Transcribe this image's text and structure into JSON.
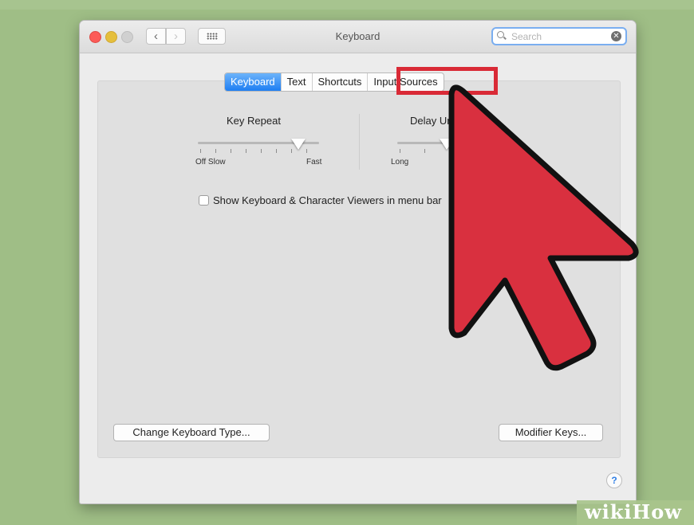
{
  "window": {
    "title": "Keyboard"
  },
  "search": {
    "placeholder": "Search"
  },
  "tabs": [
    {
      "label": "Keyboard",
      "selected": true
    },
    {
      "label": "Text",
      "selected": false
    },
    {
      "label": "Shortcuts",
      "selected": false
    },
    {
      "label": "Input Sources",
      "selected": false,
      "highlighted": true
    }
  ],
  "key_repeat": {
    "label": "Key Repeat",
    "min_label": "Off Slow",
    "max_label": "Fast",
    "value_fraction": 0.85
  },
  "delay_until_repeat": {
    "label": "Delay Until Repeat",
    "min_label": "Long",
    "value_fraction": 0.4
  },
  "checkbox": {
    "label": "Show Keyboard & Character Viewers in menu bar",
    "checked": false
  },
  "buttons": {
    "change_keyboard_type": "Change Keyboard Type...",
    "modifier_keys": "Modifier Keys...",
    "help": "?"
  },
  "colors": {
    "highlight": "#d92a36",
    "arrow": "#d9303f",
    "selected_tab": "#1e7ef2"
  },
  "icons": [
    "close-dot",
    "minimize-dot",
    "zoom-dot",
    "chevron-left-icon",
    "chevron-right-icon",
    "grid-icon",
    "search-icon",
    "clear-icon",
    "pointer-arrow-icon"
  ],
  "watermark": {
    "text": "wikiHow"
  }
}
